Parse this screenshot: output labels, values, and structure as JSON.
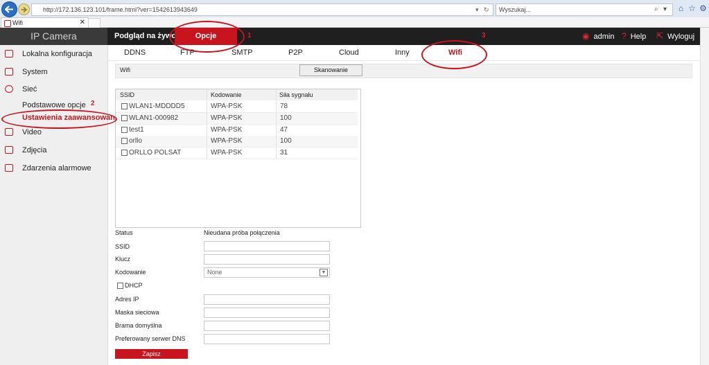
{
  "browser": {
    "url": "http://172.136.123.101/frame.html?ver=1542613943649",
    "search_placeholder": "Wyszukaj...",
    "tab_title": "Wifi"
  },
  "header": {
    "logo": "IP Camera",
    "live": "Podgląd na żywo",
    "options": "Opcje",
    "user": "admin",
    "help": "Help",
    "logout": "Wyloguj"
  },
  "sidebar": {
    "local_config": "Lokalna konfiguracja",
    "system": "System",
    "network": "Sieć",
    "basic": "Podstawowe opcje",
    "advanced": "Ustawienia zaawansowane",
    "video": "Video",
    "photos": "Zdjęcia",
    "alarms": "Zdarzenia alarmowe"
  },
  "subtabs": [
    "DDNS",
    "FTP",
    "SMTP",
    "P2P",
    "Cloud",
    "Inny",
    "Wifi"
  ],
  "scan": {
    "title": "Wifi",
    "button": "Skanowanie"
  },
  "wifi_table": {
    "headers": [
      "SSID",
      "Kodowanie",
      "Siła sygnału"
    ],
    "rows": [
      {
        "ssid": "WLAN1-MDDDD5",
        "enc": "WPA-PSK",
        "signal": "78"
      },
      {
        "ssid": "WLAN1-000982",
        "enc": "WPA-PSK",
        "signal": "100"
      },
      {
        "ssid": "test1",
        "enc": "WPA-PSK",
        "signal": "47"
      },
      {
        "ssid": "orllo",
        "enc": "WPA-PSK",
        "signal": "100"
      },
      {
        "ssid": "ORLLO POLSAT",
        "enc": "WPA-PSK",
        "signal": "31"
      }
    ]
  },
  "form": {
    "status_label": "Status",
    "status_value": "Nieudana próba połączenia",
    "ssid_label": "SSID",
    "key_label": "Klucz",
    "enc_label": "Kodowanie",
    "enc_value": "None",
    "dhcp_label": "DHCP",
    "ip_label": "Adres IP",
    "mask_label": "Maska sieciowa",
    "gateway_label": "Brama domyślna",
    "dns_label": "Preferowany serwer DNS",
    "save": "Zapisz"
  },
  "annotations": [
    "1",
    "2",
    "3"
  ],
  "colors": {
    "accent": "#c8141d",
    "header_bg": "#1f1f1f",
    "sidebar_bg": "#efefef"
  }
}
